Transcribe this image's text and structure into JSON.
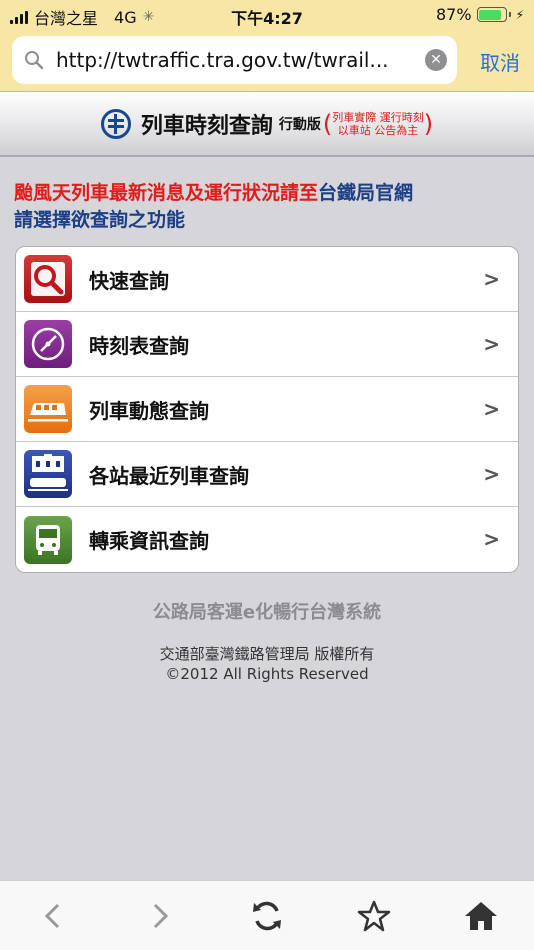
{
  "status_bar": {
    "carrier": "台灣之星",
    "network": "4G",
    "time": "下午4:27",
    "battery_percent": "87%",
    "battery_level": 0.87
  },
  "browser": {
    "url": "http://twtraffic.tra.gov.tw/twrail...",
    "cancel_label": "取消"
  },
  "header": {
    "title": "列車時刻查詢",
    "mobile_label": "行動版",
    "notice_line1": "列車實際 運行時刻",
    "notice_line2": "以車站 公告為主"
  },
  "intro": {
    "typhoon_text": "颱風天列車最新消息及運行狀況請至",
    "tra_link": "台鐵局官網",
    "instruction": "請選擇欲查詢之功能"
  },
  "menu": {
    "items": [
      {
        "label": "快速查詢",
        "icon": "magnifier-icon"
      },
      {
        "label": "時刻表查詢",
        "icon": "clock-icon"
      },
      {
        "label": "列車動態查詢",
        "icon": "train-icon"
      },
      {
        "label": "各站最近列車查詢",
        "icon": "station-icon"
      },
      {
        "label": "轉乘資訊查詢",
        "icon": "bus-icon"
      }
    ],
    "chevron": ">"
  },
  "footer": {
    "tagline": "公路局客運e化暢行台灣系統",
    "copyright_line1": "交通部臺灣鐵路管理局 版權所有",
    "copyright_line2": "©2012 All Rights Reserved"
  },
  "colors": {
    "accent_red": "#e21b1b",
    "link_blue": "#1c3f86",
    "browser_bar": "#f7e6a6"
  }
}
